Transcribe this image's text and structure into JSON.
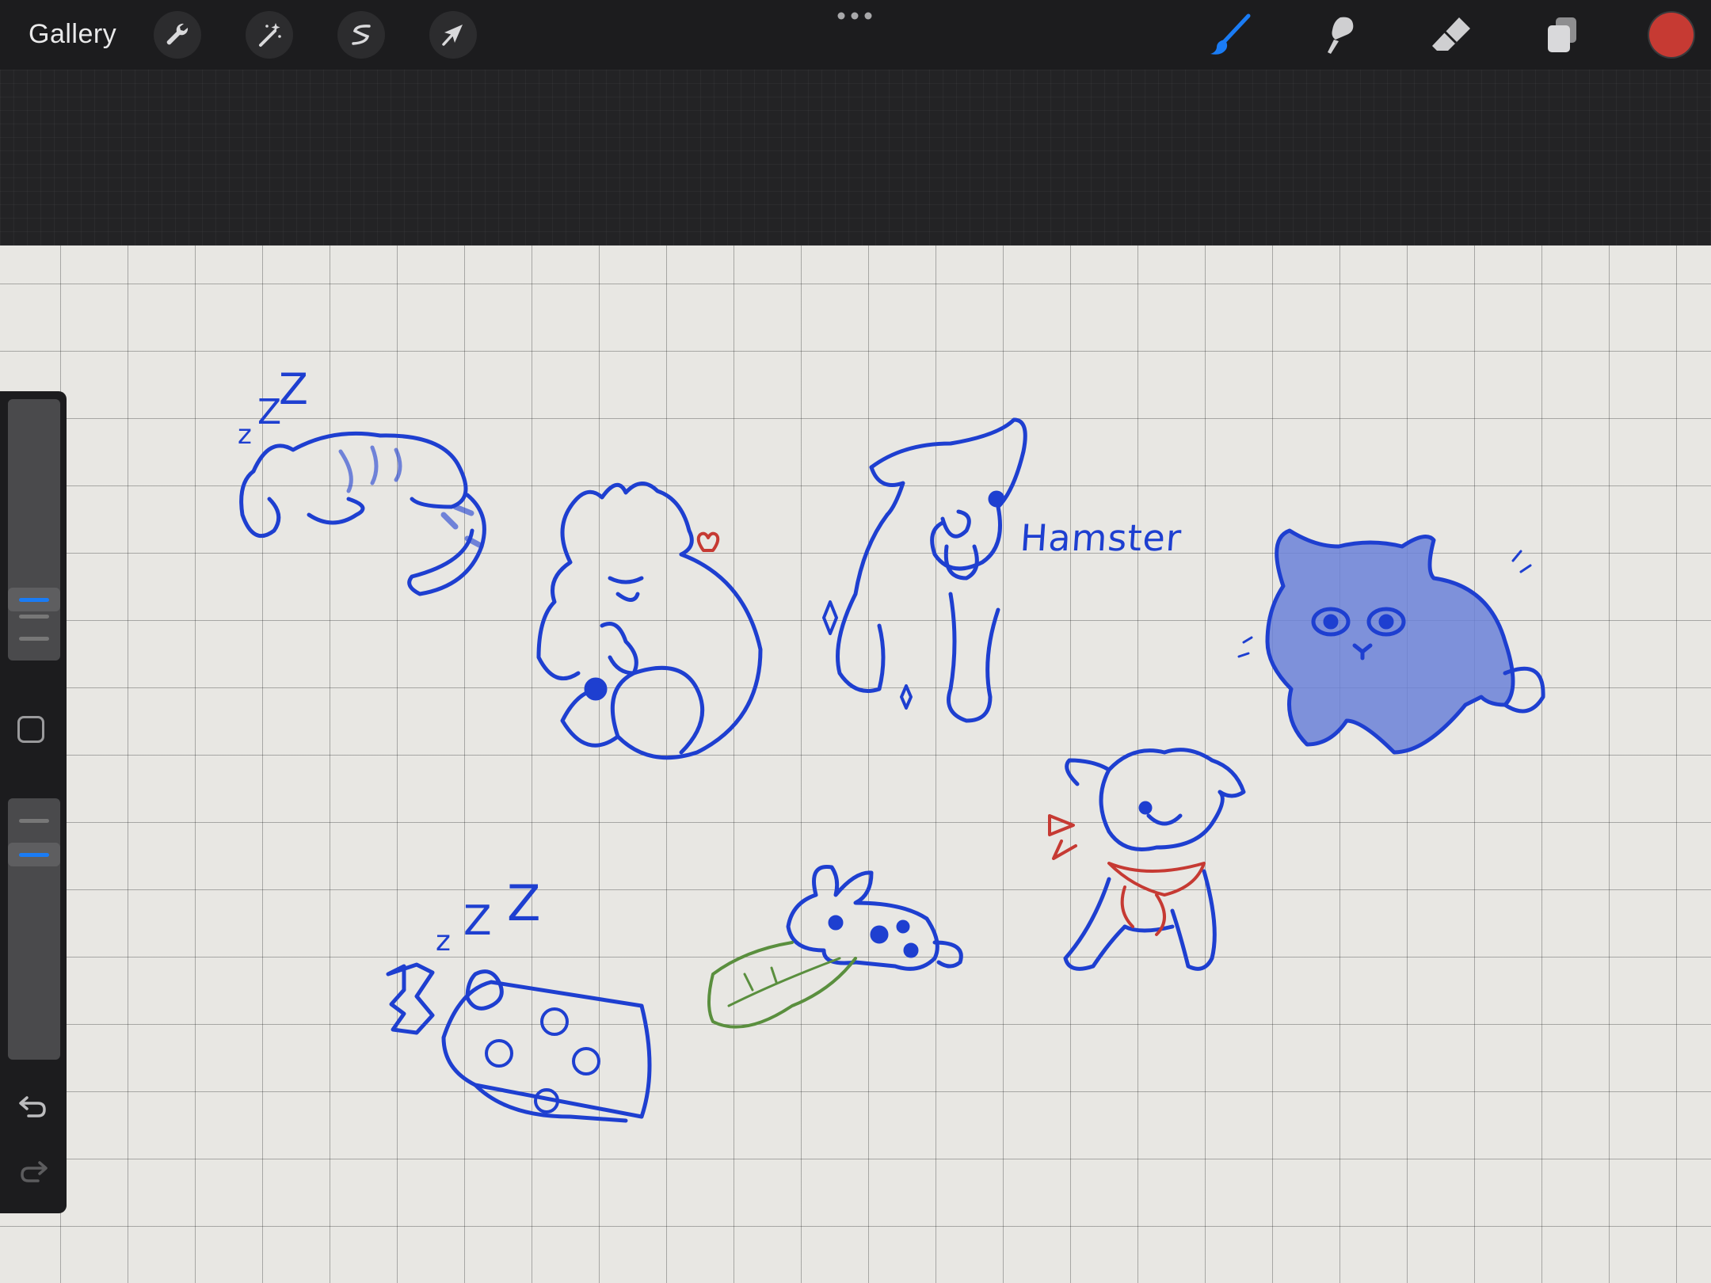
{
  "toolbar": {
    "gallery_label": "Gallery",
    "left_tools": [
      "wrench-icon",
      "magic-wand-icon",
      "selection-icon",
      "transform-arrow-icon"
    ],
    "more_menu": "more-dots-icon",
    "right_tools": [
      "brush-icon",
      "smudge-icon",
      "eraser-icon",
      "layers-icon"
    ],
    "active_tool": "brush-icon",
    "brush_active_color": "#1a7cf5",
    "current_color": "#c63a33"
  },
  "canvas": {
    "background": "#e8e7e3",
    "grid": true,
    "stroke_color": "#1e3fd0",
    "annotations": {
      "hamster_label": "Hamster"
    }
  },
  "sidebar": {
    "brush_size": 0.65,
    "opacity": 0.9,
    "modifier": "square-modifier-icon",
    "undo": "undo-icon",
    "redo": "redo-icon"
  }
}
